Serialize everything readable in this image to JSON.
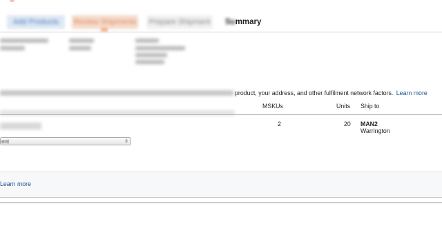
{
  "tabs": [
    {
      "label": "Add Products",
      "state": "done"
    },
    {
      "label": "Review Shipments",
      "state": "current"
    },
    {
      "label": "Prepare Shipment",
      "state": "pending"
    },
    {
      "label": "Summary",
      "state": "pending",
      "visible_part": "mmary"
    }
  ],
  "info": {
    "text": "product, your address, and other fulfilment network factors.",
    "link": "Learn more"
  },
  "table": {
    "headers": {
      "mskus": "MSKUs",
      "units": "Units",
      "ship_to": "Ship to"
    },
    "row": {
      "mskus": "2",
      "units": "20",
      "ship_to_code": "MAN2",
      "ship_to_city": "Warrington",
      "select_value": "ent"
    }
  },
  "bottom": {
    "link": "Learn more"
  },
  "colors": {
    "link": "#1b4f8f",
    "tab_done": "#4a7dbf",
    "tab_current": "#e08a5a",
    "panel_bg": "#f7f8f9"
  },
  "icons": {
    "select_arrow": "updown-chevron-icon"
  }
}
